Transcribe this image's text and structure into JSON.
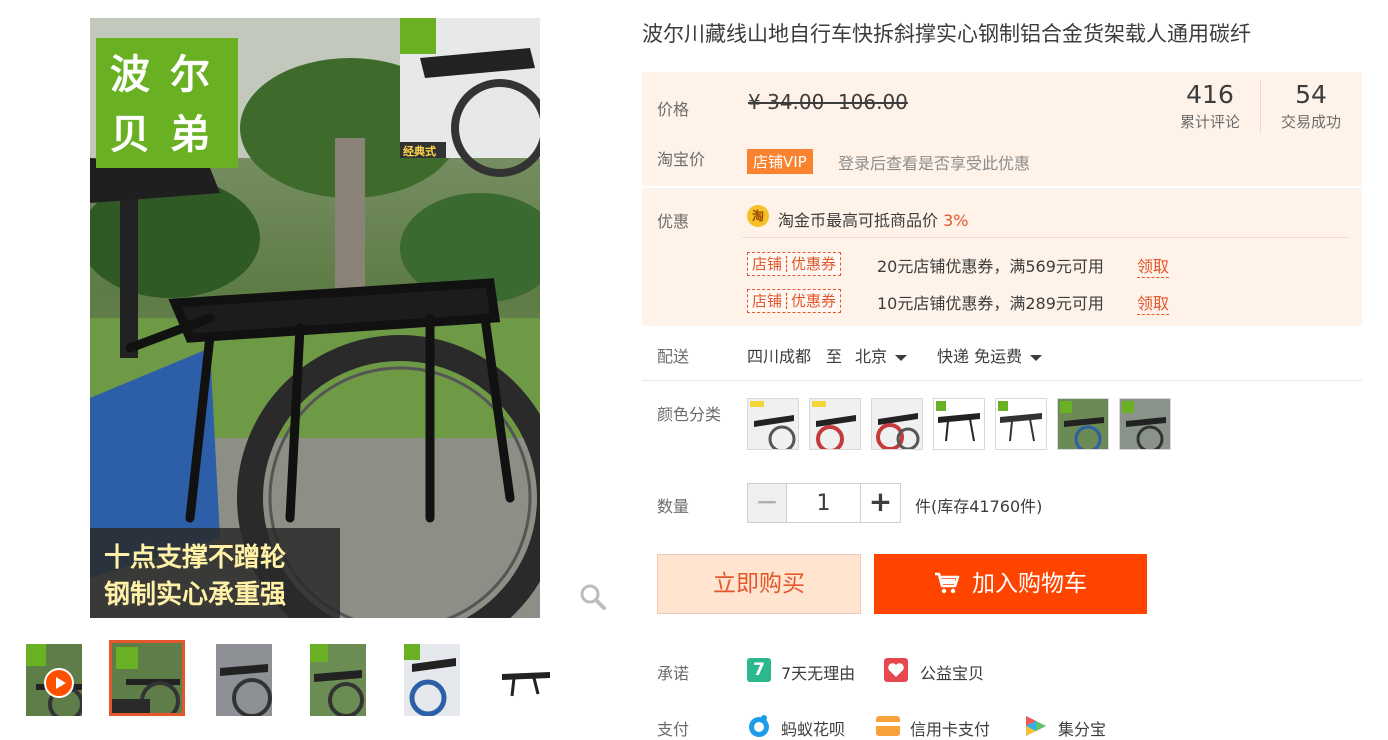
{
  "gallery": {
    "brand": [
      "波",
      "尔",
      "贝",
      "弟"
    ],
    "badge": "经典式",
    "banner_line1": "十点支撑不蹭轮",
    "banner_line2": "钢制实心承重强",
    "thumbnails": [
      "video",
      "image",
      "image",
      "image",
      "image",
      "image"
    ],
    "selected_index": 1
  },
  "product": {
    "title": "波尔川藏线山地自行车快拆斜撑实心钢制铝合金货架载人通用碳纤"
  },
  "price": {
    "label": "价格",
    "value": "¥ 34.00 -106.00",
    "taobao_label": "淘宝价",
    "vip_badge": "店铺VIP",
    "vip_text": "登录后查看是否享受此优惠",
    "reviews_count": "416",
    "reviews_label": "累计评论",
    "sales_count": "54",
    "sales_label": "交易成功"
  },
  "promo": {
    "label": "优惠",
    "coin_icon": "淘",
    "coin_text": "淘金币最高可抵商品价",
    "coin_pct": "3%",
    "coupons": [
      {
        "tag": "店铺┊优惠券",
        "desc": "20元店铺优惠券，满569元可用",
        "action": "领取"
      },
      {
        "tag": "店铺┊优惠券",
        "desc": "10元店铺优惠券，满289元可用",
        "action": "领取"
      }
    ]
  },
  "shipping": {
    "label": "配送",
    "from": "四川成都",
    "to_word": "至",
    "to": "北京",
    "method": "快递 免运费"
  },
  "colors": {
    "label": "颜色分类",
    "swatches": [
      "swatch-1",
      "swatch-2",
      "swatch-3",
      "swatch-4",
      "swatch-5",
      "swatch-6",
      "swatch-7"
    ]
  },
  "quantity": {
    "label": "数量",
    "value": "1",
    "minus": "−",
    "plus": "+",
    "stock": "件(库存41760件)"
  },
  "actions": {
    "buy_now": "立即购买",
    "add_cart": "加入购物车"
  },
  "promise": {
    "label": "承诺",
    "items": [
      "7天无理由",
      "公益宝贝"
    ],
    "seven_icon": "7"
  },
  "payment": {
    "label": "支付",
    "items": [
      "蚂蚁花呗",
      "信用卡支付",
      "集分宝"
    ]
  },
  "theme": {
    "accent": "#ff4400",
    "accent_text": "#e4572d",
    "price_bg": "#fff2e8",
    "brand_green": "#6ab023"
  }
}
